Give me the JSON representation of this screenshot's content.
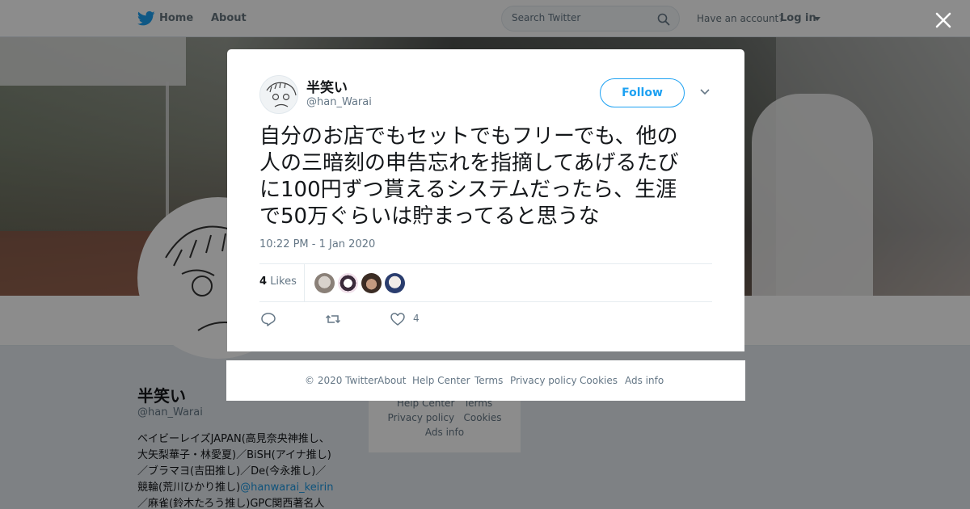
{
  "nav": {
    "home_label": "Home",
    "about_label": "About",
    "search_placeholder": "Search Twitter",
    "have_account": "Have an account?",
    "login_label": "Log in"
  },
  "profile": {
    "name": "半笑い",
    "handle": "@han_Warai",
    "bio_lines": [
      "ベイビーレイズJAPAN(高見奈央神推し、",
      "大矢梨華子・林愛夏)／BiSH(アイナ推し)",
      "／ブラマヨ(吉田推し)／De(今永推し)／",
      "競輪(荒川ひかり推し)",
      "／麻雀(鈴木たろう推し)GPC関西著名人"
    ],
    "bio_link": "@hanwarai_keirin",
    "side_footer": [
      "Help Center",
      "Terms",
      "Privacy policy",
      "Cookies",
      "Ads info"
    ]
  },
  "tweet": {
    "author_name": "半笑い",
    "author_handle": "@han_Warai",
    "follow_label": "Follow",
    "text_lines": [
      "自分のお店でもセットでもフリーでも、他の",
      "人の三暗刻の申告忘れを指摘してあげるたび",
      "に100円ずつ貰えるシステムだったら、生涯",
      "で50万ぐらいは貯まってると思うな"
    ],
    "timestamp": "10:22 PM - 1 Jan 2020",
    "likes_count": "4",
    "likes_label": "Likes",
    "like_action_count": "4"
  },
  "footer": {
    "copyright": "© 2020 Twitter",
    "links": [
      "About",
      "Help Center",
      "Terms",
      "Privacy policy",
      "Cookies",
      "Ads info"
    ]
  },
  "colors": {
    "accent": "#1da1f2",
    "text": "#14171a",
    "muted": "#657786"
  },
  "icons": [
    "twitter-bird-icon",
    "search-icon",
    "caret-down-icon",
    "close-icon",
    "chevron-down-icon",
    "reply-icon",
    "retweet-icon",
    "heart-icon"
  ]
}
